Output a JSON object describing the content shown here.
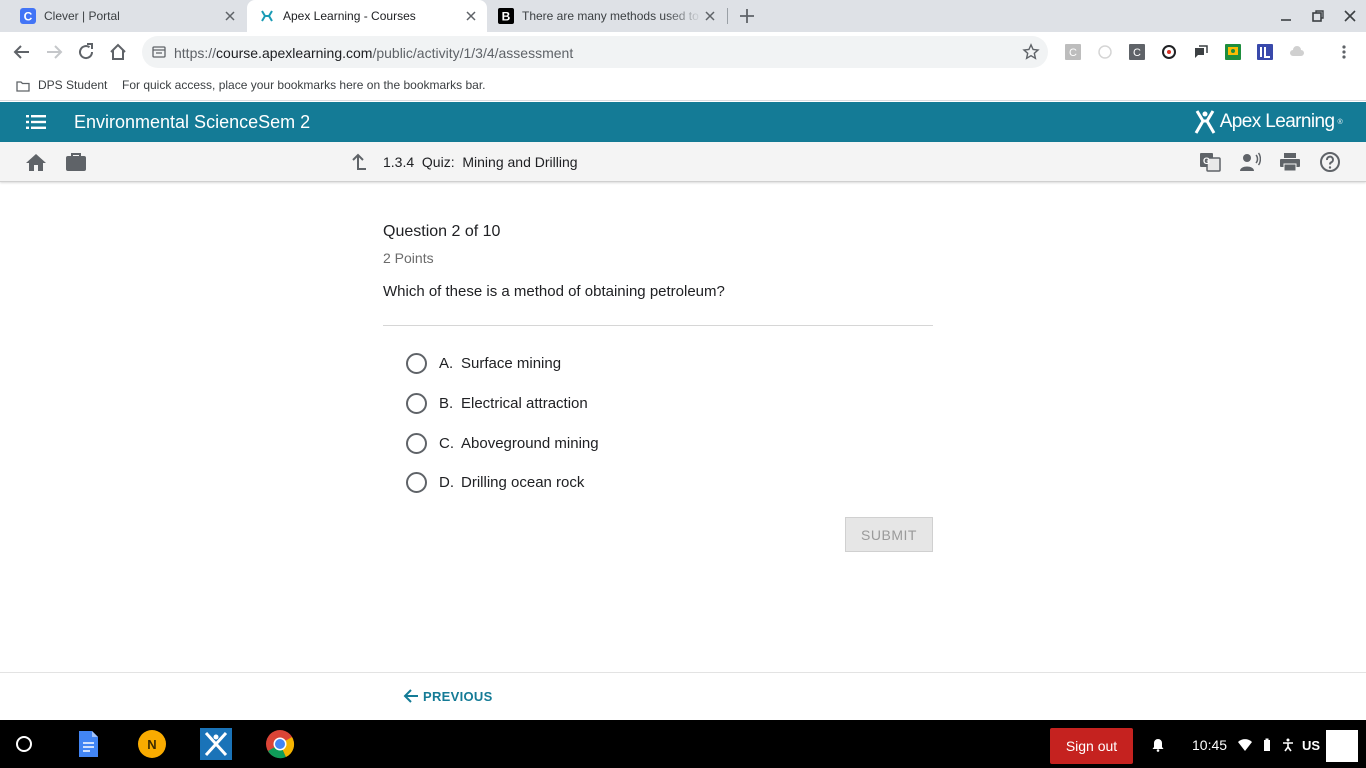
{
  "browser": {
    "tabs": [
      {
        "title": "Clever | Portal",
        "active": false,
        "favicon": "clever-c-icon"
      },
      {
        "title": "Apex Learning - Courses",
        "active": true,
        "favicon": "apex-logo-icon"
      },
      {
        "title": "There are many methods used to",
        "active": false,
        "favicon": "brainly-b-icon"
      }
    ],
    "url_scheme": "https://",
    "url_host": "course.apexlearning.com",
    "url_path": "/public/activity/1/3/4/assessment",
    "extension_letters": [
      "C",
      "C"
    ],
    "bookmarks": {
      "folder": "DPS Student",
      "hint": "For quick access, place your bookmarks here on the bookmarks bar."
    }
  },
  "app": {
    "course_title": "Environmental ScienceSem 2",
    "brand": "Apex Learning",
    "brand_mark": "®",
    "breadcrumb": "1.3.4  Quiz:  Mining and Drilling"
  },
  "quiz": {
    "question_label": "Question 2 of 10",
    "points": "2 Points",
    "prompt": "Which of these is a method of obtaining petroleum?",
    "choices": [
      {
        "letter": "A.",
        "text": "Surface mining"
      },
      {
        "letter": "B.",
        "text": "Electrical attraction"
      },
      {
        "letter": "C.",
        "text": "Aboveground mining"
      },
      {
        "letter": "D.",
        "text": "Drilling ocean rock"
      }
    ],
    "submit_label": "SUBMIT",
    "previous_label": "PREVIOUS"
  },
  "shelf": {
    "notes_letter": "N",
    "signout_label": "Sign out",
    "time": "10:45",
    "locale": "US"
  },
  "colors": {
    "brand_teal": "#147b96",
    "signout_red": "#c5221f",
    "tab_strip": "#dee1e6"
  }
}
